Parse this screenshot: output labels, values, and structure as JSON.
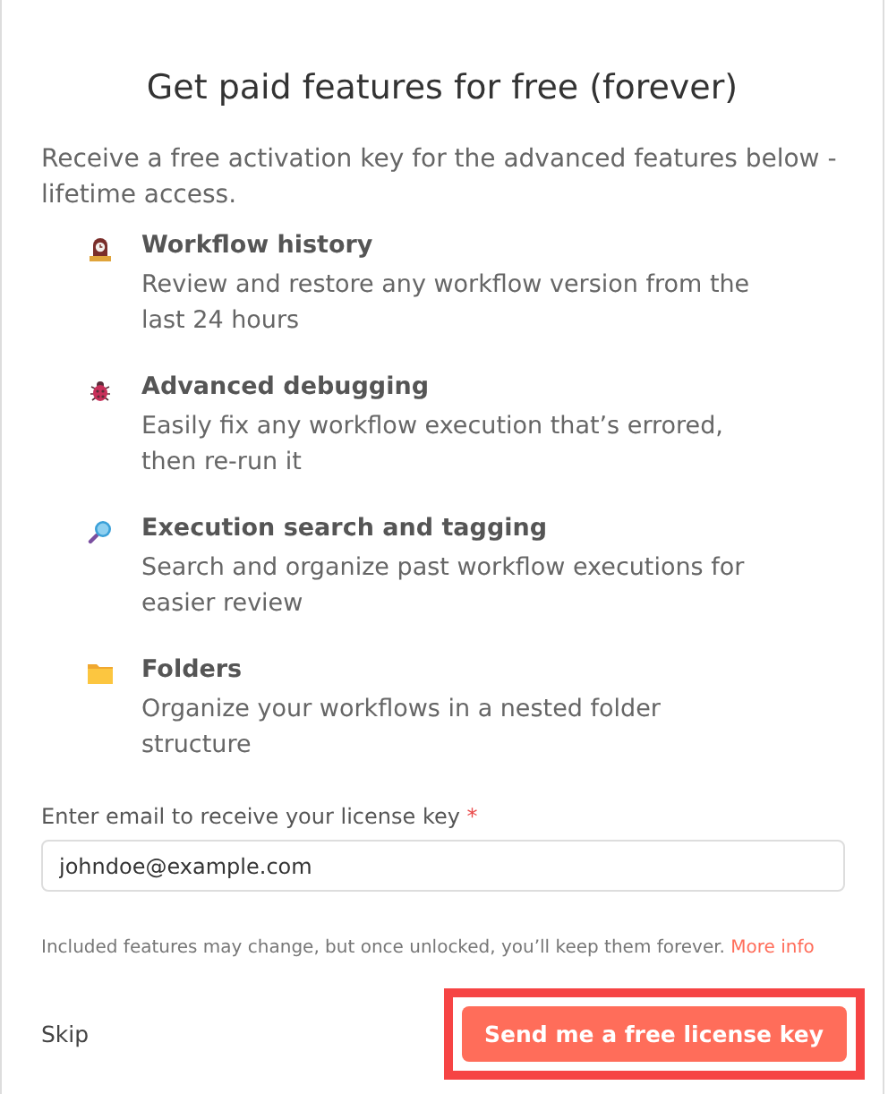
{
  "title": "Get paid features for free (forever)",
  "description": "Receive a free activation key for the advanced features below - lifetime access.",
  "features": [
    {
      "kind": "clock",
      "title": "Workflow history",
      "text": "Review and restore any workflow version from the last 24 hours"
    },
    {
      "kind": "bug",
      "title": "Advanced debugging",
      "text": "Easily fix any workflow execution that’s errored, then re-run it"
    },
    {
      "kind": "magnifier",
      "title": "Execution search and tagging",
      "text": "Search and organize past workflow executions for easier review"
    },
    {
      "kind": "folder",
      "title": "Folders",
      "text": "Organize your workflows in a nested folder structure"
    }
  ],
  "email": {
    "label": "Enter email to receive your license key",
    "required_mark": "*",
    "value": "johndoe@example.com"
  },
  "note": {
    "text": "Included features may change, but once unlocked, you’ll keep them forever.",
    "link": "More info"
  },
  "skip_button": "Skip",
  "submit_button": {
    "label": "Send me a free license key",
    "highlighted": true
  }
}
